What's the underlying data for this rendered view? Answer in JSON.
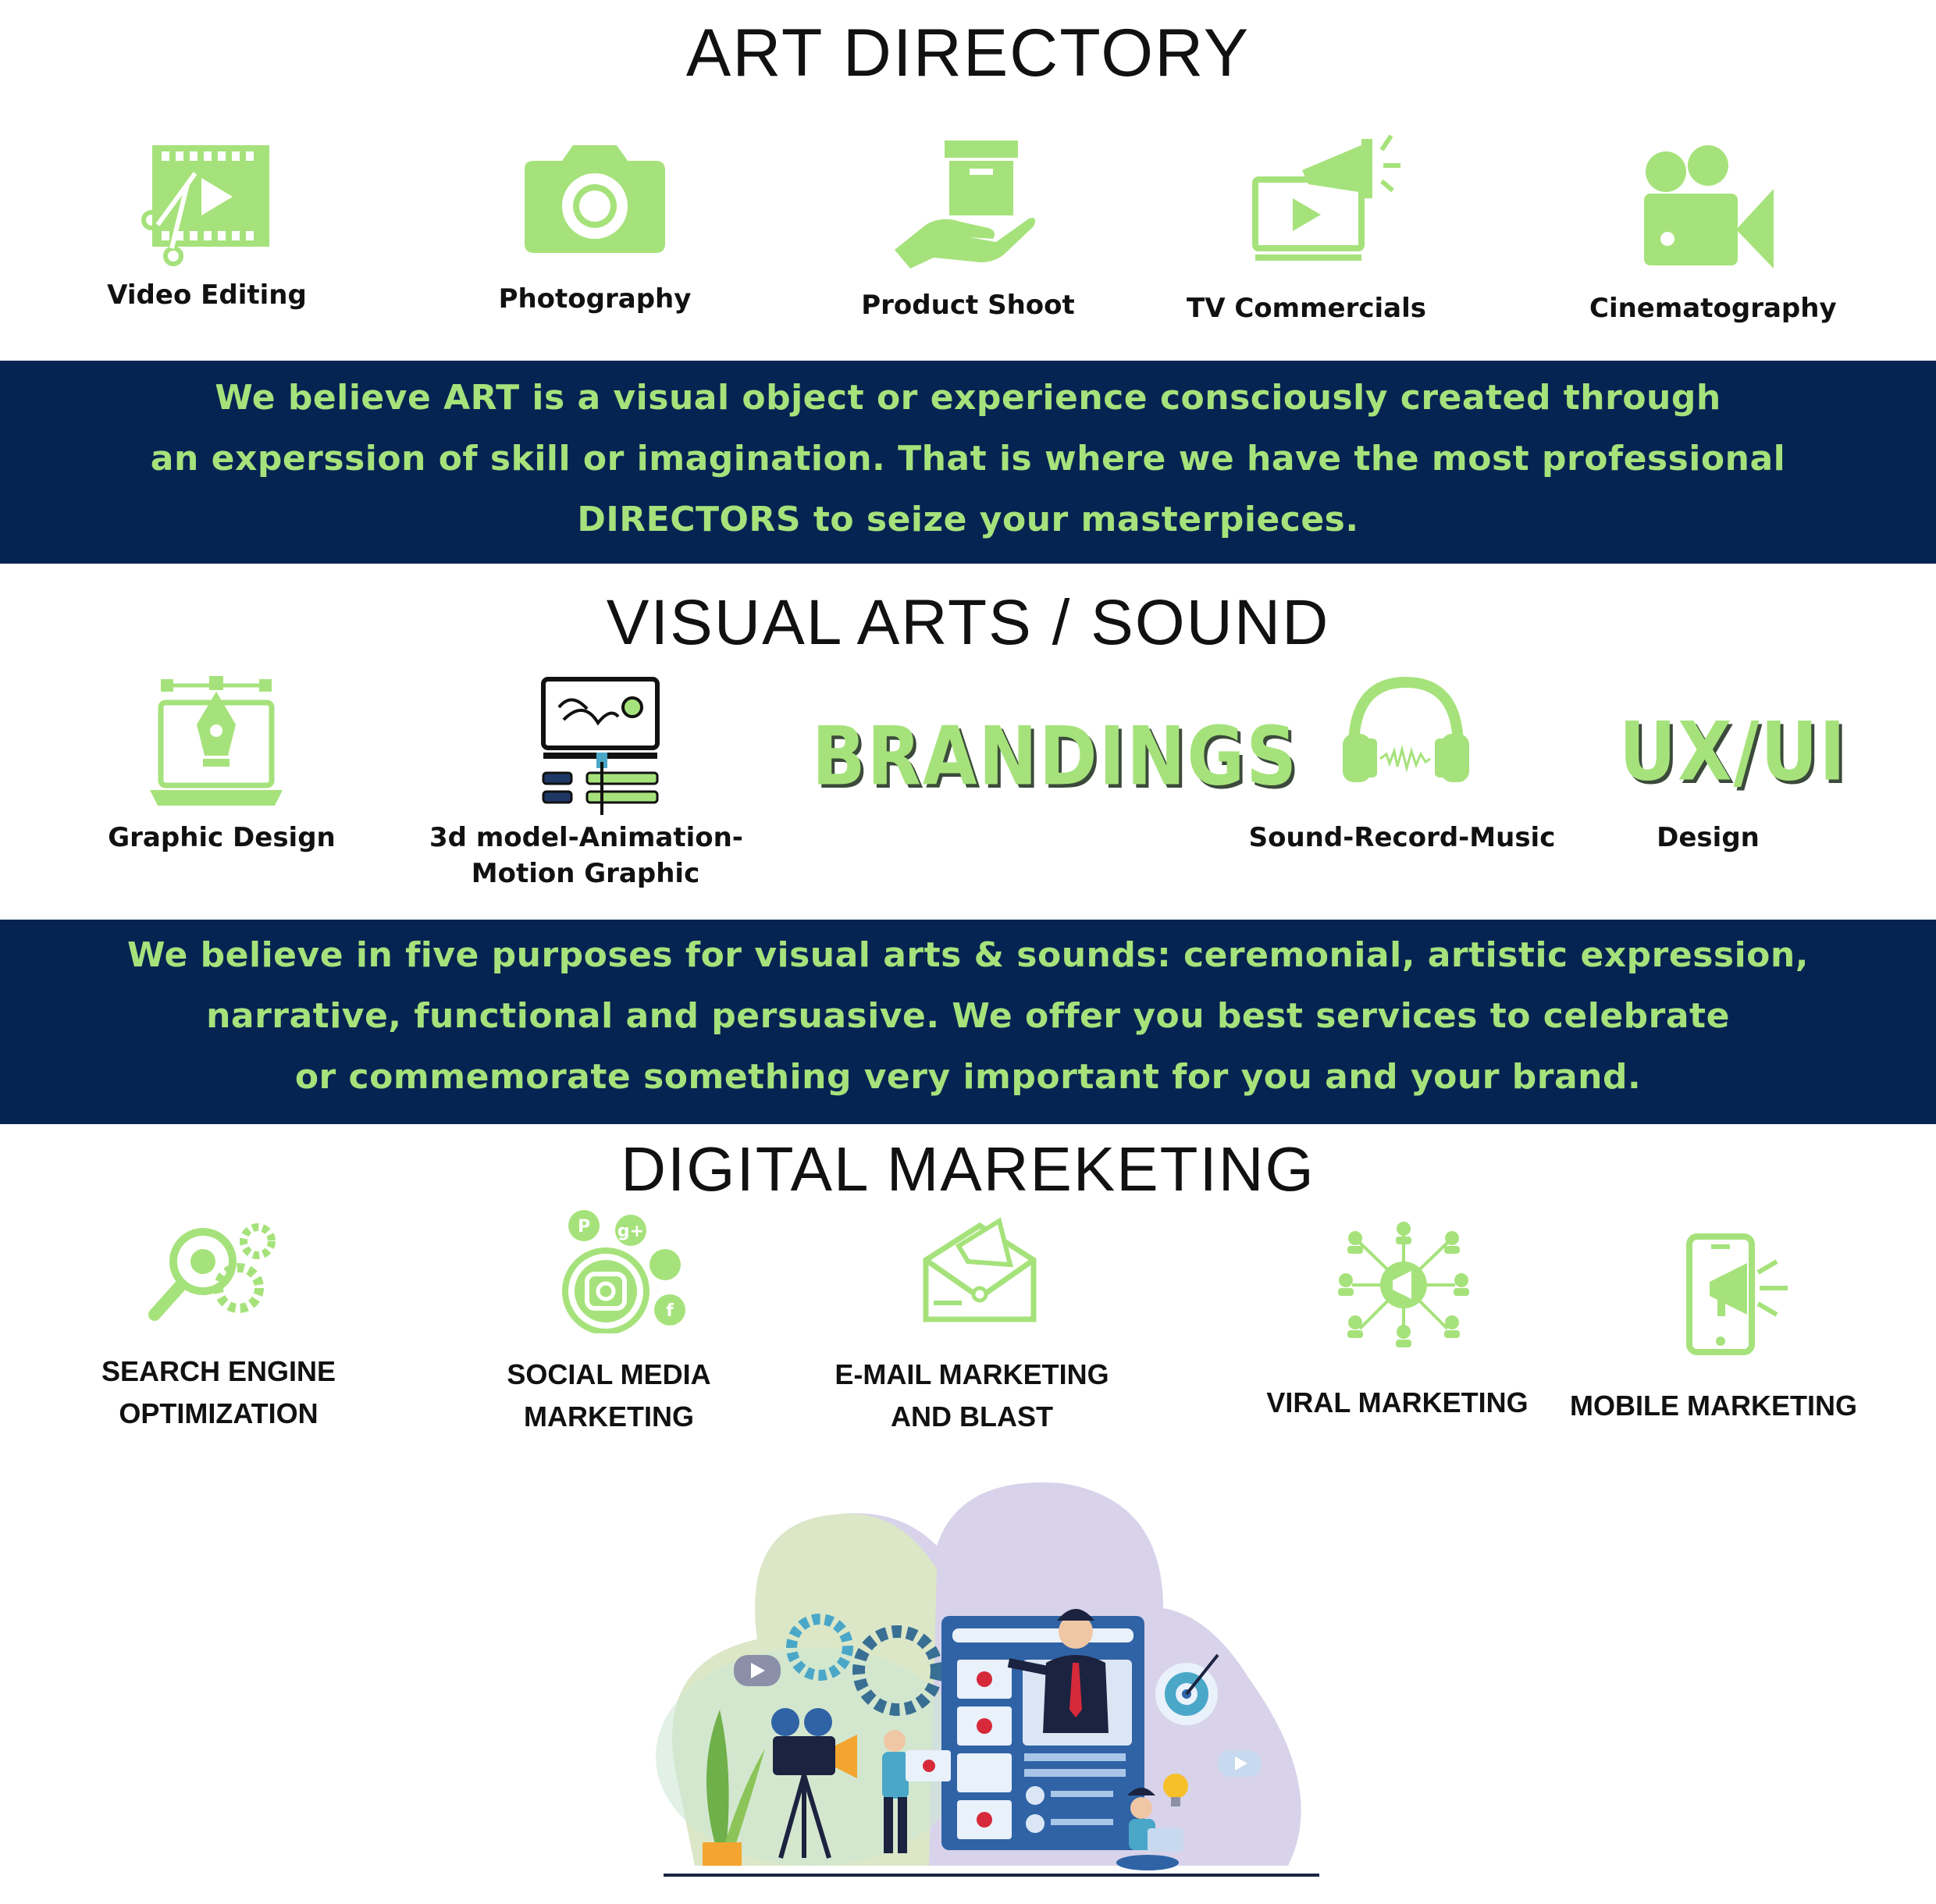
{
  "colors": {
    "accent_green": "#a6e27b",
    "band_navy": "#052452",
    "text_dark": "#111111"
  },
  "art_directory": {
    "title": "ART DIRECTORY",
    "items": [
      {
        "label": "Video Editing",
        "icon": "film-scissors-icon"
      },
      {
        "label": "Photography",
        "icon": "camera-icon"
      },
      {
        "label": "Product Shoot",
        "icon": "hand-box-icon"
      },
      {
        "label": "TV Commercials",
        "icon": "tv-megaphone-icon"
      },
      {
        "label": "Cinematography",
        "icon": "movie-camera-icon"
      }
    ],
    "band_lines": [
      "We believe ART is a visual object or experience consciously created through",
      "an experssion of skill or imagination. That is where we have the most professional",
      "DIRECTORS to seize your masterpieces."
    ]
  },
  "visual_arts": {
    "title": "VISUAL ARTS / SOUND",
    "items": [
      {
        "label": "Graphic Design",
        "icon": "pen-tool-laptop-icon"
      },
      {
        "label_line1": "3d model-Animation-",
        "label_line2": "Motion Graphic",
        "icon": "animation-monitor-icon"
      },
      {
        "wordmark": "BRANDINGS"
      },
      {
        "label": "Sound-Record-Music",
        "icon": "headphones-icon"
      },
      {
        "wordmark": "UX/UI",
        "label": "Design"
      }
    ],
    "band_lines": [
      "We believe in five purposes for visual arts & sounds: ceremonial, artistic expression,",
      "narrative, functional and persuasive. We offer you best services to celebrate",
      "or commemorate something very important for you and your brand."
    ]
  },
  "digital_marketing": {
    "title": "DIGITAL MAREKETING",
    "items": [
      {
        "label_line1": "SEARCH ENGINE",
        "label_line2": "OPTIMIZATION",
        "icon": "magnifier-gears-icon"
      },
      {
        "label_line1": "SOCIAL MEDIA",
        "label_line2": "MARKETING",
        "icon": "social-media-icon"
      },
      {
        "label_line1": "E-MAIL MARKETING",
        "label_line2": "AND BLAST",
        "icon": "envelope-megaphone-icon"
      },
      {
        "label": "VIRAL MARKETING",
        "icon": "network-megaphone-icon"
      },
      {
        "label": "MOBILE MARKETING",
        "icon": "phone-megaphone-icon"
      }
    ]
  },
  "illustration": {
    "icon": "video-marketing-illustration"
  }
}
